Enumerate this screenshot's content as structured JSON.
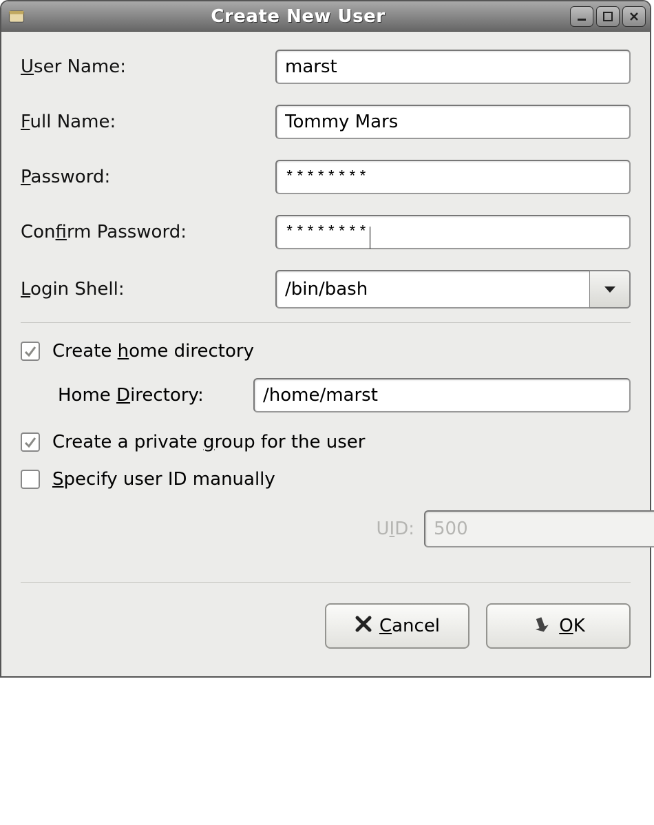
{
  "window": {
    "title": "Create New User"
  },
  "form": {
    "user_name_label": "User Name:",
    "user_name_value": "marst",
    "full_name_label": "Full Name:",
    "full_name_value": "Tommy Mars",
    "password_label": "Password:",
    "password_value": "********",
    "confirm_label": "Confirm Password:",
    "confirm_value": "********",
    "login_shell_label": "Login Shell:",
    "login_shell_value": "/bin/bash"
  },
  "options": {
    "create_home_label": "Create home directory",
    "create_home_checked": true,
    "home_dir_label": "Home Directory:",
    "home_dir_value": "/home/marst",
    "private_group_label": "Create a private group for the user",
    "private_group_checked": true,
    "specify_uid_label": "Specify user ID manually",
    "specify_uid_checked": false,
    "uid_label": "UID:",
    "uid_value": "500"
  },
  "buttons": {
    "cancel": "Cancel",
    "ok": "OK"
  }
}
